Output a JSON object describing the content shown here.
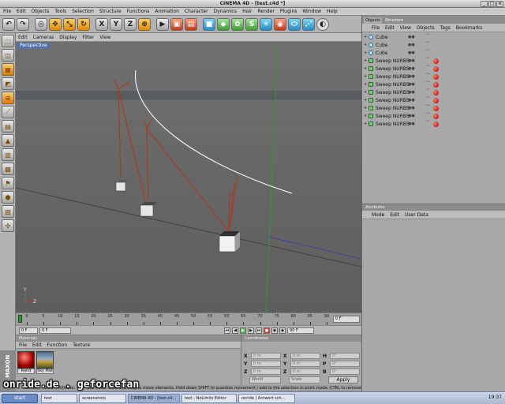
{
  "window": {
    "title": "CINEMA 4D - [test.c4d *]"
  },
  "menubar": [
    "File",
    "Edit",
    "Objects",
    "Tools",
    "Selection",
    "Structure",
    "Functions",
    "Animation",
    "Character",
    "Dynamics",
    "Hair",
    "Render",
    "Plugins",
    "Window",
    "Help"
  ],
  "toolbar": {
    "icons": [
      "undo-icon",
      "redo-icon",
      "live-select-icon",
      "move-icon",
      "scale-icon",
      "rotate-icon",
      "axis-x-icon",
      "axis-y-icon",
      "axis-z-icon",
      "world-coords-icon",
      "render-view-icon",
      "render-picture-icon",
      "render-settings-icon",
      "cube-object-icon",
      "nurbs-icon",
      "array-icon",
      "spline-icon",
      "light-icon",
      "scene-icon",
      "deformer-icon",
      "camera-icon",
      "sky-icon"
    ],
    "labels": [
      "↶",
      "↷",
      "◎",
      "✥",
      "⤡",
      "↻",
      "X",
      "Y",
      "Z",
      "⊕",
      "▶",
      "▣",
      "▤",
      "■",
      "◆",
      "✿",
      "S",
      "✳",
      "◉",
      "⬭",
      "⋰",
      "◐"
    ]
  },
  "left_tools": {
    "icons": [
      "model-icon",
      "object-icon",
      "texture-icon",
      "animation-icon",
      "points-icon",
      "edges-icon",
      "polygons-icon",
      "tweak-icon",
      "workplane-icon",
      "snap-icon",
      "axis-icon",
      "render-region-icon",
      "checker-icon",
      "layout-icon"
    ],
    "labels": [
      "⬚",
      "◫",
      "▦",
      "◩",
      "⊞",
      "⟋",
      "▤",
      "▲",
      "▥",
      "▩",
      "⚑",
      "⬢",
      "▨",
      "✣"
    ]
  },
  "logo_text": "MAXON CINEMA 4D",
  "viewport": {
    "menu": [
      "Edit",
      "Cameras",
      "Display",
      "Filter",
      "View"
    ],
    "label": "Perspective"
  },
  "timeline": {
    "ticks": [
      "0",
      "5",
      "10",
      "15",
      "20",
      "25",
      "30",
      "35",
      "40",
      "45",
      "50",
      "55",
      "60",
      "65",
      "70",
      "75",
      "80",
      "85",
      "90"
    ],
    "end_frame": "0 F",
    "start_field": "0 F",
    "current_field": "0 F",
    "max_field": "90 F"
  },
  "materials": {
    "header": "Materials",
    "menu": [
      "File",
      "Edit",
      "Function",
      "Texture"
    ],
    "items": [
      "Rand",
      "Sky Mat"
    ]
  },
  "coordinates": {
    "header": "Coordinates",
    "rows": [
      {
        "a": "X",
        "b": "X",
        "c": "H"
      },
      {
        "a": "Y",
        "b": "Y",
        "c": "P"
      },
      {
        "a": "Z",
        "b": "Z",
        "c": "B"
      }
    ],
    "fields": [
      "0 m",
      "0 m",
      "0°",
      "0 m",
      "0 m",
      "0°",
      "0 m",
      "0 m",
      "0°"
    ],
    "world": "World",
    "scale": "Scale",
    "apply": "Apply"
  },
  "status": "Azimuth: 423.1°, Altitude: -8.6° SW   Move: Click and drag to move elements. Hold down SHIFT to quantize movement / add to the selection in point mode, CTRL to remove.",
  "object_manager": {
    "tabs": [
      "Objects",
      "Structure"
    ],
    "menu": [
      "File",
      "Edit",
      "View",
      "Objects",
      "Tags",
      "Bookmarks"
    ],
    "objects": [
      {
        "name": "Cube",
        "type": "cube",
        "ball": false
      },
      {
        "name": "Cube",
        "type": "cube",
        "ball": false
      },
      {
        "name": "Cube",
        "type": "cube",
        "ball": false
      },
      {
        "name": "Sweep NURBS",
        "type": "sweep",
        "ball": true
      },
      {
        "name": "Sweep NURBS",
        "type": "sweep",
        "ball": true
      },
      {
        "name": "Sweep NURBS",
        "type": "sweep",
        "ball": true
      },
      {
        "name": "Sweep NURBS",
        "type": "sweep",
        "ball": true
      },
      {
        "name": "Sweep NURBS",
        "type": "sweep",
        "ball": true
      },
      {
        "name": "Sweep NURBS",
        "type": "sweep",
        "ball": true
      },
      {
        "name": "Sweep NURBS",
        "type": "sweep",
        "ball": true
      },
      {
        "name": "Sweep NURBS",
        "type": "sweep",
        "ball": true
      },
      {
        "name": "Sweep NURBS",
        "type": "sweep",
        "ball": true
      }
    ]
  },
  "attributes": {
    "header": "Attributes",
    "menu": [
      "Mode",
      "Edit",
      "User Data"
    ]
  },
  "taskbar": {
    "start": "start",
    "tasks": [
      "test",
      "screenshots",
      "CINEMA 4D - [test.c4...",
      "test - NoLimits Editor",
      "onride | Antwort sch..."
    ],
    "active": 2,
    "clock": "19:37"
  },
  "watermark": "onride.de . geforcefan",
  "colors": {
    "viewport_bg": "#666666",
    "axis_green": "#2e9a3a",
    "axis_blue": "#3040b0",
    "spline_white": "#ffffff",
    "sweep_red": "#a83a25"
  }
}
